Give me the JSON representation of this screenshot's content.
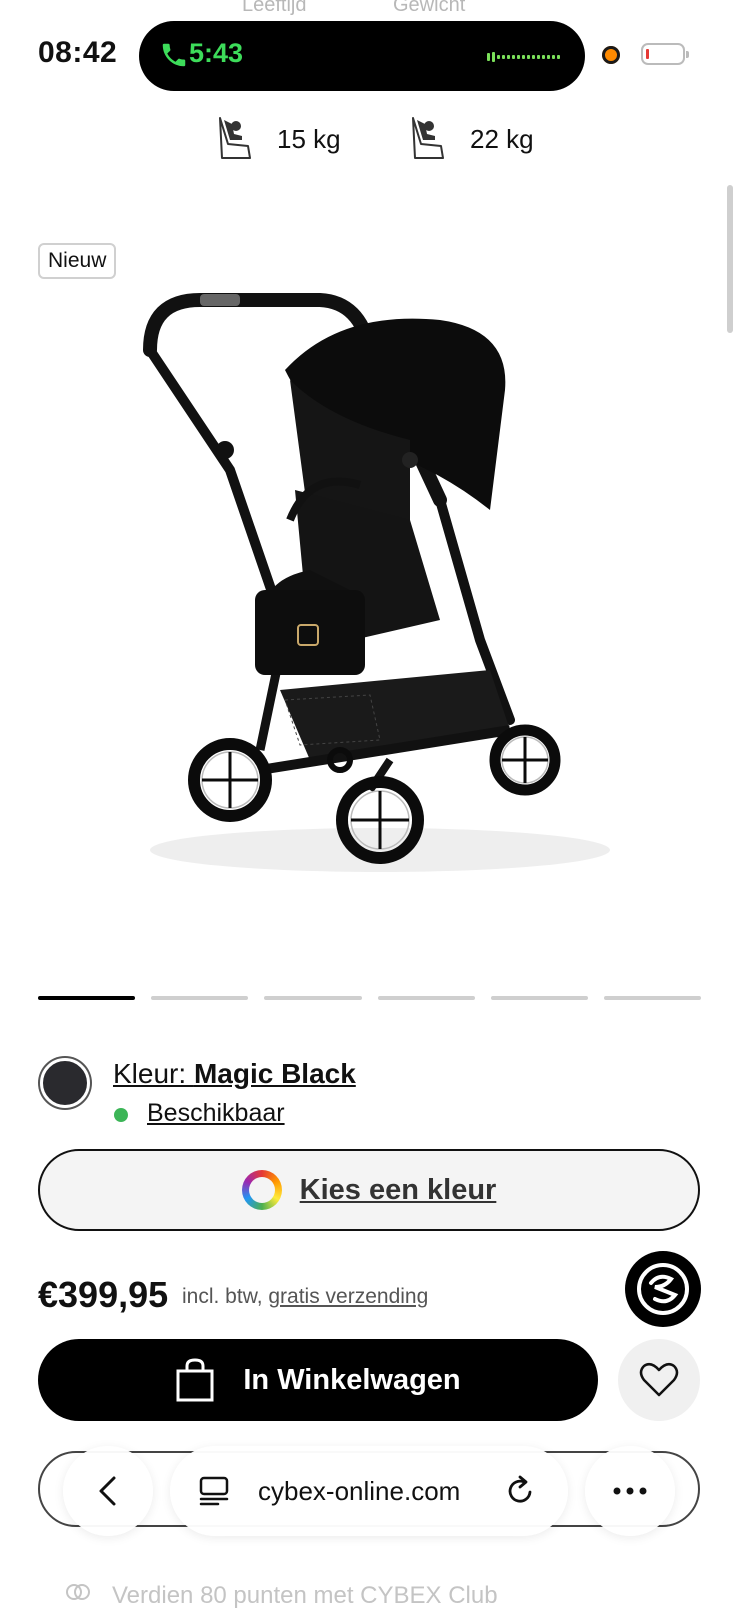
{
  "status_bar": {
    "time": "08:42",
    "call_time": "5:43",
    "faded_labels": [
      "Leeftijd",
      "Gewicht"
    ]
  },
  "specs": [
    {
      "value": "15 kg",
      "icon": "car-seat-icon"
    },
    {
      "value": "22 kg",
      "icon": "car-seat-icon"
    }
  ],
  "product": {
    "badge": "Nieuw",
    "gallery": {
      "count": 6,
      "active_index": 0
    },
    "color_prefix": "Kleur: ",
    "color_name": "Magic Black",
    "availability": "Beschikbaar",
    "choose_color_label": "Kies een kleur",
    "price": "€399,95",
    "price_note": "incl. btw, ",
    "shipping_link": "gratis verzending",
    "add_to_cart_label": "In Winkelwagen"
  },
  "browser": {
    "url": "cybex-online.com"
  },
  "footer": {
    "club_text": "Verdien 80 punten met CYBEX Club"
  },
  "colors": {
    "accent_green": "#3ddc5a",
    "available_dot": "#3cb557",
    "swatch": "#2a2a2e",
    "primary_button": "#000000"
  }
}
